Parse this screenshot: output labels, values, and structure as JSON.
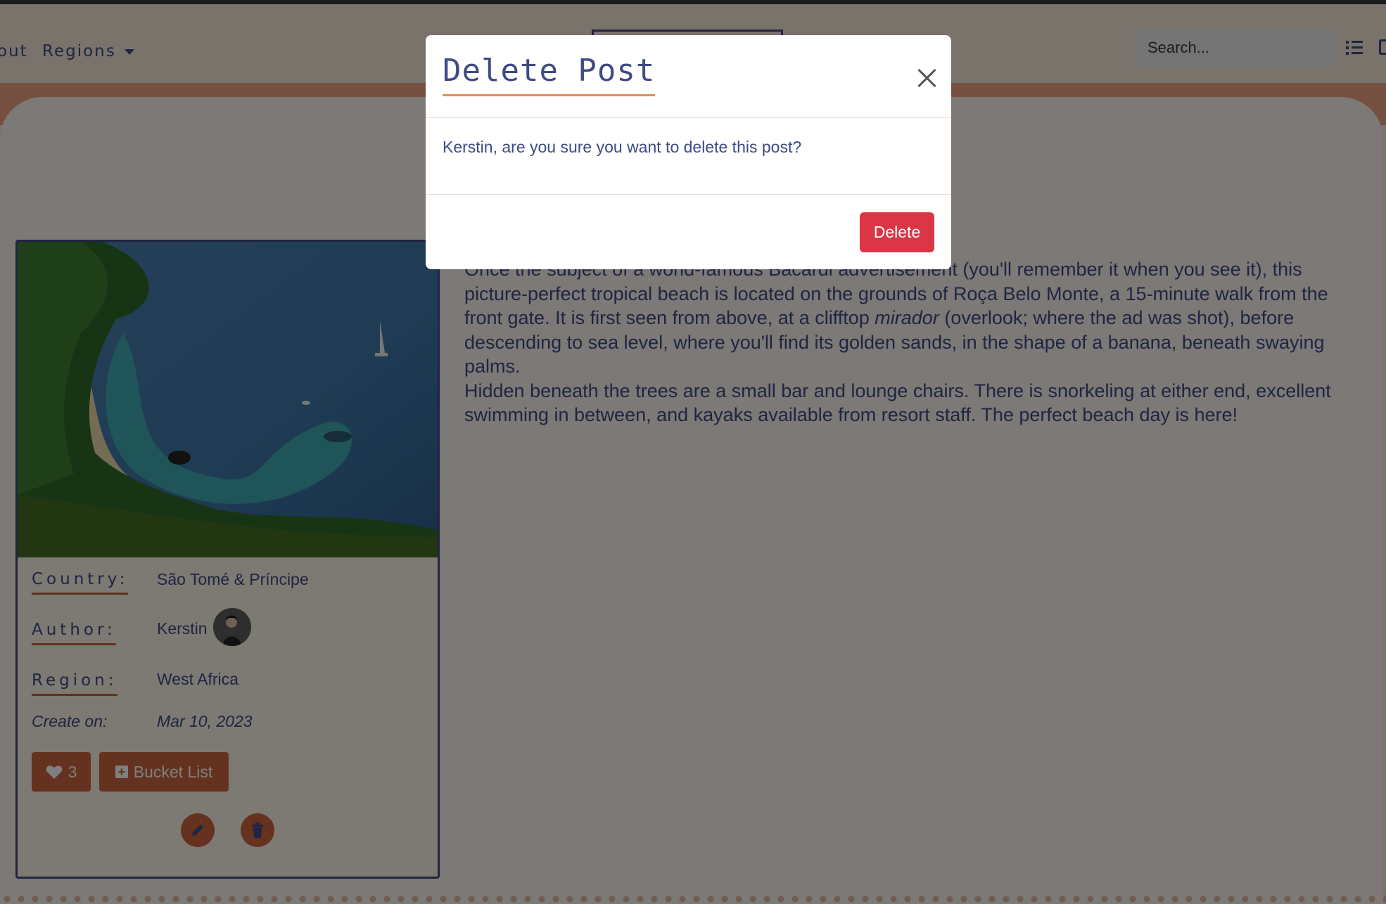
{
  "nav": {
    "about_partial": "out",
    "regions_label": "Regions",
    "search_placeholder": "Search..."
  },
  "post": {
    "paragraph1_pre": "Once the subject of a world-famous Bacardi advertisement (you'll remember it when you see it), this picture-perfect tropical beach is located on the grounds of Roça Belo Monte, a 15-minute walk from the front gate. It is first seen from above, at a clifftop ",
    "paragraph1_em": "mirador",
    "paragraph1_post": " (overlook; where the ad was shot), before descending to sea level, where you'll find its golden sands, in the shape of a banana, beneath swaying palms.",
    "paragraph2": "Hidden beneath the trees are a small bar and lounge chairs. There is snorkeling at either end, excellent swimming in between, and kayaks available from resort staff. The perfect beach day is here!"
  },
  "card": {
    "country_label": "Country:",
    "country_value": "São Tomé & Príncipe",
    "author_label": "Author:",
    "author_value": "Kerstin",
    "region_label": "Region:",
    "region_value": "West Africa",
    "created_label": "Create on:",
    "created_value": "Mar 10, 2023",
    "likes": "3",
    "bucket_label": "Bucket List"
  },
  "modal": {
    "title": "Delete Post",
    "message": "Kerstin, are you sure you want to delete this post?",
    "delete_label": "Delete"
  },
  "colors": {
    "accent_orange": "#c8643c",
    "navy": "#3f4a86",
    "danger": "#dc3545"
  },
  "icons": [
    "heart-icon",
    "plus-square-icon",
    "pencil-icon",
    "trash-icon",
    "list-icon",
    "close-icon",
    "chevron-down-icon"
  ]
}
